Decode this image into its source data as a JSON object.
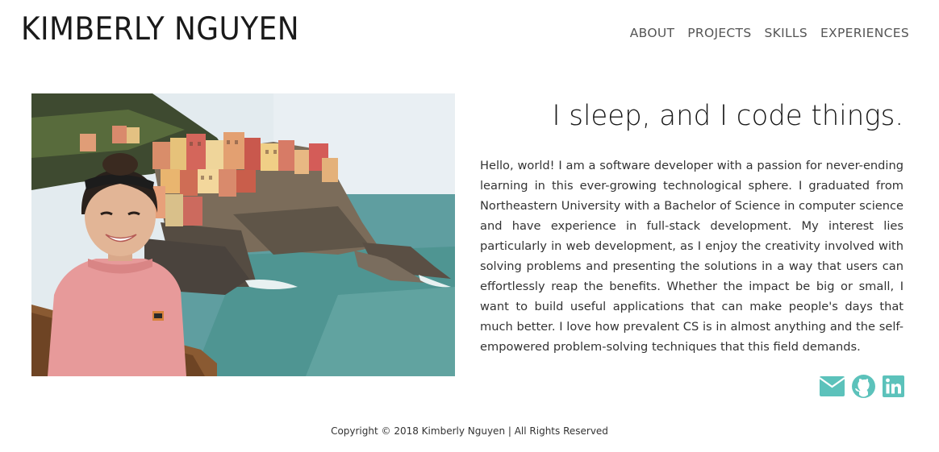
{
  "header": {
    "title": "KIMBERLY NGUYEN",
    "nav": [
      {
        "label": "ABOUT"
      },
      {
        "label": "PROJECTS"
      },
      {
        "label": "SKILLS"
      },
      {
        "label": "EXPERIENCES"
      }
    ]
  },
  "about": {
    "headline": "I sleep, and I code things.",
    "bio": "Hello, world! I am a software developer with a passion for never-ending learning in this ever-growing technological sphere. I graduated from Northeastern University with a Bachelor of Science in computer science and have experience in full-stack development. My interest lies particularly in web development, as I enjoy the creativity involved with solving problems and presenting the solutions in a way that users can effortlessly reap the benefits. Whether the impact be big or small, I want to build useful applications that can make people's days that much better. I love how prevalent CS is in almost anything and the self-empowered problem-solving techniques that this field demands.",
    "socials": [
      {
        "icon": "envelope-icon"
      },
      {
        "icon": "github-icon"
      },
      {
        "icon": "linkedin-icon"
      }
    ]
  },
  "footer": {
    "copyright": "Copyright © 2018 Kimberly Nguyen | All Rights Reserved"
  },
  "colors": {
    "accent": "#5cc2bb",
    "title": "#1a1a1a",
    "nav": "#555555"
  }
}
